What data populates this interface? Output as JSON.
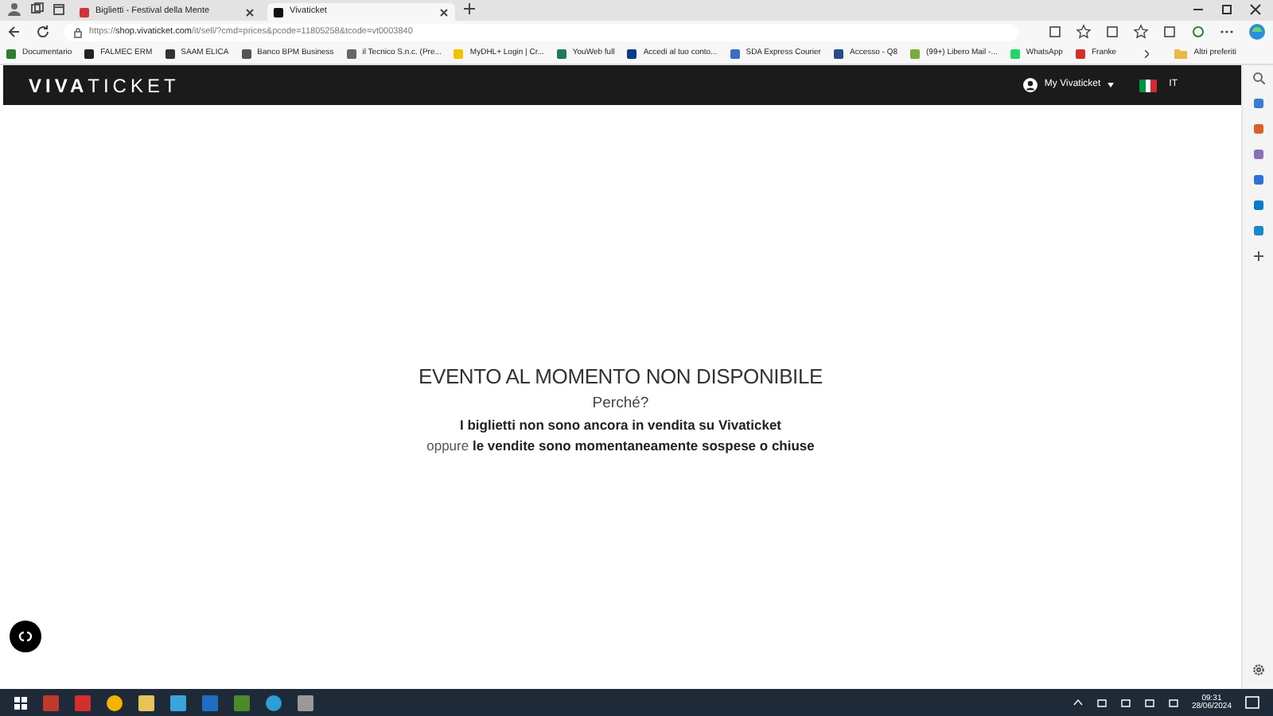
{
  "browser_tabs": [
    {
      "title": "Biglietti - Festival della Mente",
      "selected": false,
      "color": "#d13438"
    },
    {
      "title": "Vivaticket",
      "selected": true,
      "color": "#111111"
    }
  ],
  "address_bar": {
    "url": "https://**shop.vivaticket.com**/it/sell/?cmd=prices&pcode=11805258&tcode=vt0003840"
  },
  "bookmarks": [
    {
      "label": "Documentario",
      "color": "#2e7d32"
    },
    {
      "label": "FALMEC ERM",
      "color": "#222222"
    },
    {
      "label": "SAAM ELICA",
      "color": "#333333"
    },
    {
      "label": "Banco BPM Business",
      "color": "#555555"
    },
    {
      "label": "il Tecnico S.n.c. (Pre...",
      "color": "#666666"
    },
    {
      "label": "MyDHL+ Login | Cr...",
      "color": "#f2c200"
    },
    {
      "label": "YouWeb full",
      "color": "#1e7b5a"
    },
    {
      "label": "Accedi al tuo conto...",
      "color": "#0f3a8c"
    },
    {
      "label": "SDA Express Courier",
      "color": "#3b6fc4"
    },
    {
      "label": "Accesso - Q8",
      "color": "#2b4a8a"
    },
    {
      "label": "(99+) Libero Mail -...",
      "color": "#7aa93c"
    },
    {
      "label": "WhatsApp",
      "color": "#25d366"
    },
    {
      "label": "Franke",
      "color": "#d32f2f"
    }
  ],
  "other_bookmarks": "Altri preferiti",
  "site_header": {
    "logo": "**VIVA**TICKET",
    "account": "My Vivaticket",
    "language": "IT"
  },
  "message": {
    "title": "EVENTO AL MOMENTO NON DISPONIBILE",
    "question": "Perché?",
    "reason_1": "I biglietti non sono ancora in vendita su Vivaticket",
    "reason_2": "oppure **le vendite sono momentaneamente sospese o chiuse**"
  },
  "taskbar": {
    "time": "09:31",
    "date": "28/06/2024"
  }
}
